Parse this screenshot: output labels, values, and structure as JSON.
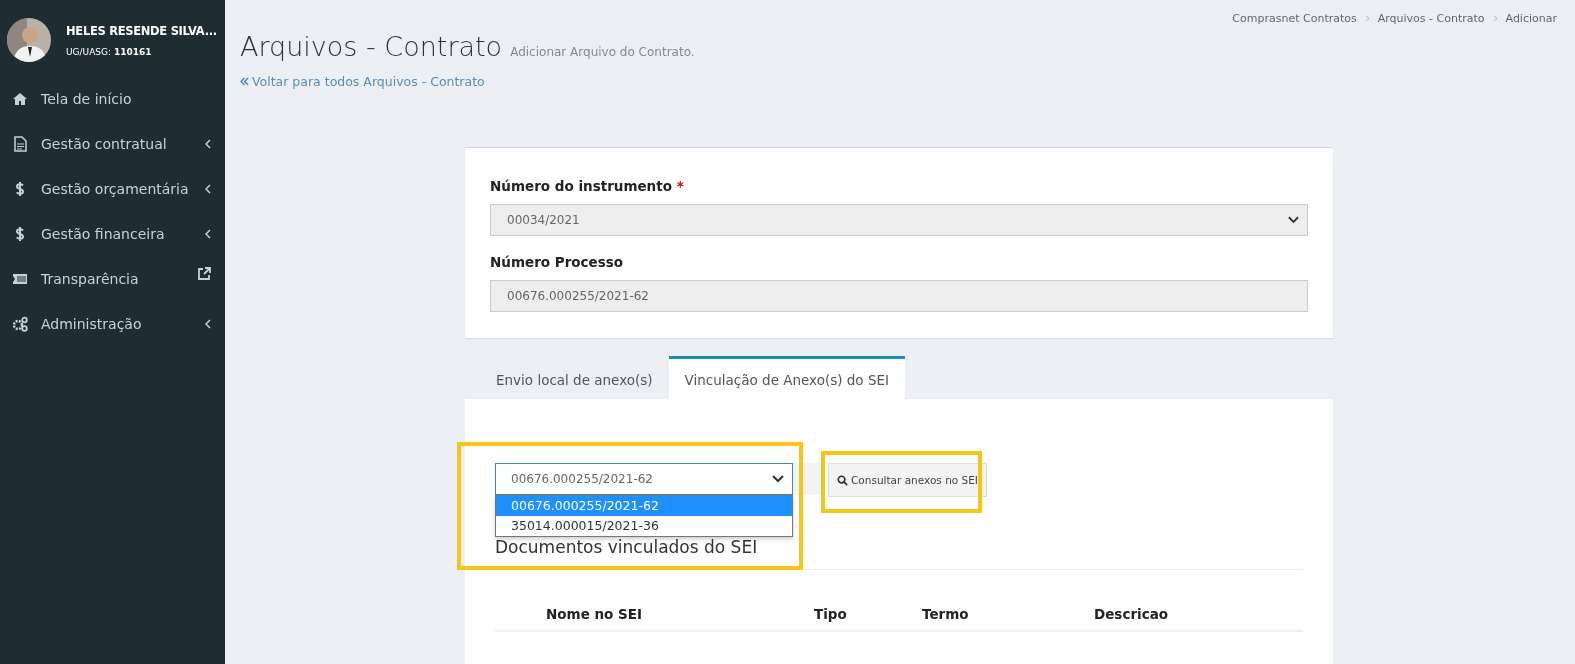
{
  "user": {
    "name": "HELES RESENDE SILVA...",
    "unit_label": "UG/UASG:",
    "unit_code": "110161"
  },
  "sidebar": {
    "items": [
      {
        "label": "Tela de início",
        "expandable": false,
        "external_link": false
      },
      {
        "label": "Gestão contratual",
        "expandable": true,
        "external_link": false
      },
      {
        "label": "Gestão orçamentária",
        "expandable": true,
        "external_link": false
      },
      {
        "label": "Gestão financeira",
        "expandable": true,
        "external_link": false
      },
      {
        "label": "Transparência",
        "expandable": false,
        "external_link": true
      },
      {
        "label": "Administração",
        "expandable": true,
        "external_link": false
      }
    ]
  },
  "breadcrumb": [
    "Comprasnet Contratos",
    "Arquivos - Contrato",
    "Adicionar"
  ],
  "page": {
    "title": "Arquivos - Contrato",
    "subtitle": "Adicionar Arquivo do Contrato.",
    "back_link": "Voltar para todos Arquivos - Contrato"
  },
  "form": {
    "fields": [
      {
        "label": "Número do instrumento",
        "required_marker": "*",
        "kind": "select",
        "value": "00034/2021"
      },
      {
        "label": "Número Processo",
        "kind": "text",
        "value": "00676.000255/2021-62"
      }
    ]
  },
  "tabs": [
    {
      "label": "Envio local de anexo(s)",
      "selected": false
    },
    {
      "label": "Vinculação de Anexo(s) do SEI",
      "selected": true
    }
  ],
  "sei": {
    "select": {
      "value": "00676.000255/2021-62",
      "highlighted": true,
      "options": [
        {
          "label": "00676.000255/2021-62",
          "selected": true
        },
        {
          "label": "35014.000015/2021-36",
          "selected": false
        }
      ]
    },
    "button": {
      "label": "Consultar anexos no SEI",
      "highlighted": true
    },
    "heading": "Documentos vinculados do SEI",
    "table": {
      "columns": [
        "Nome no SEI",
        "Tipo",
        "Termo",
        "Descricao"
      ]
    }
  }
}
